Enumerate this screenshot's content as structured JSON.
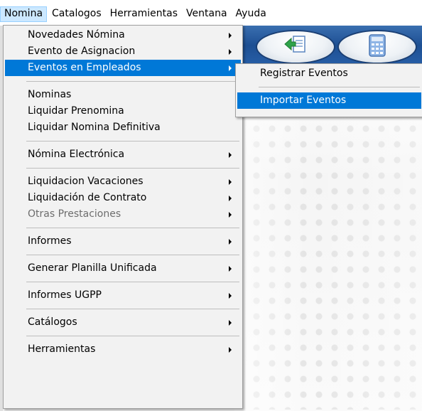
{
  "menubar": {
    "items": [
      "Nomina",
      "Catalogos",
      "Herramientas",
      "Ventana",
      "Ayuda"
    ],
    "active_index": 0
  },
  "main_menu": {
    "groups": [
      [
        {
          "label": "Novedades Nómina",
          "submenu": true
        },
        {
          "label": "Evento de Asignacion",
          "submenu": true
        },
        {
          "label": "Eventos en Empleados",
          "submenu": true,
          "highlighted": true
        }
      ],
      [
        {
          "label": "Nominas"
        },
        {
          "label": "Liquidar Prenomina"
        },
        {
          "label": "Liquidar Nomina Definitiva"
        }
      ],
      [
        {
          "label": "Nómina Electrónica",
          "submenu": true
        }
      ],
      [
        {
          "label": "Liquidacion Vacaciones",
          "submenu": true
        },
        {
          "label": "Liquidación de Contrato",
          "submenu": true
        },
        {
          "label": "Otras Prestaciones",
          "submenu": true,
          "disabled": true
        }
      ],
      [
        {
          "label": "Informes",
          "submenu": true
        }
      ],
      [
        {
          "label": "Generar Planilla Unificada",
          "submenu": true
        }
      ],
      [
        {
          "label": "Informes UGPP",
          "submenu": true
        }
      ],
      [
        {
          "label": "Catálogos",
          "submenu": true
        }
      ],
      [
        {
          "label": "Herramientas",
          "submenu": true
        }
      ]
    ]
  },
  "sub_menu": {
    "groups": [
      [
        {
          "label": "Registrar Eventos"
        }
      ],
      [
        {
          "label": "Importar Eventos",
          "highlighted": true
        }
      ]
    ]
  },
  "toolbar": {
    "buttons": [
      {
        "icon": "import-document-icon"
      },
      {
        "icon": "calculator-icon"
      }
    ]
  },
  "colors": {
    "highlight": "#0078d7",
    "menubar_active": "#cce8ff",
    "toolbar": "#1d4f93"
  }
}
